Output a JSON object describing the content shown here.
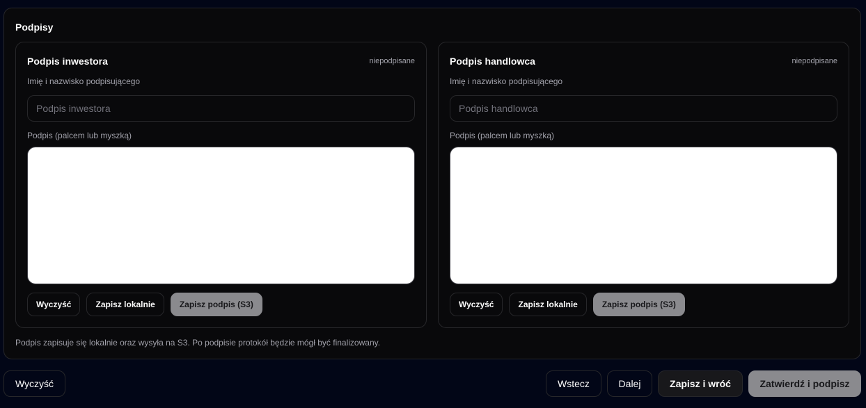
{
  "section": {
    "title": "Podpisy",
    "note": "Podpis zapisuje się lokalnie oraz wysyła na S3. Po podpisie protokół będzie mógł być finalizowany."
  },
  "investor": {
    "title": "Podpis inwestora",
    "status": "niepodpisane",
    "name_label": "Imię i nazwisko podpisującego",
    "name_value": "",
    "name_placeholder": "Podpis inwestora",
    "signature_label": "Podpis (palcem lub myszką)",
    "clear_label": "Wyczyść",
    "save_local_label": "Zapisz lokalnie",
    "save_s3_label": "Zapisz podpis (S3)"
  },
  "trader": {
    "title": "Podpis handlowca",
    "status": "niepodpisane",
    "name_label": "Imię i nazwisko podpisującego",
    "name_value": "",
    "name_placeholder": "Podpis handlowca",
    "signature_label": "Podpis (palcem lub myszką)",
    "clear_label": "Wyczyść",
    "save_local_label": "Zapisz lokalnie",
    "save_s3_label": "Zapisz podpis (S3)"
  },
  "footer": {
    "clear_label": "Wyczyść",
    "back_label": "Wstecz",
    "next_label": "Dalej",
    "save_return_label": "Zapisz i wróć",
    "confirm_sign_label": "Zatwierdź i podpisz"
  },
  "colors": {
    "page_background": "#020617",
    "panel_background": "#09090b",
    "border": "#27272a",
    "muted_button": "#8a8a8e",
    "canvas": "#ffffff"
  }
}
